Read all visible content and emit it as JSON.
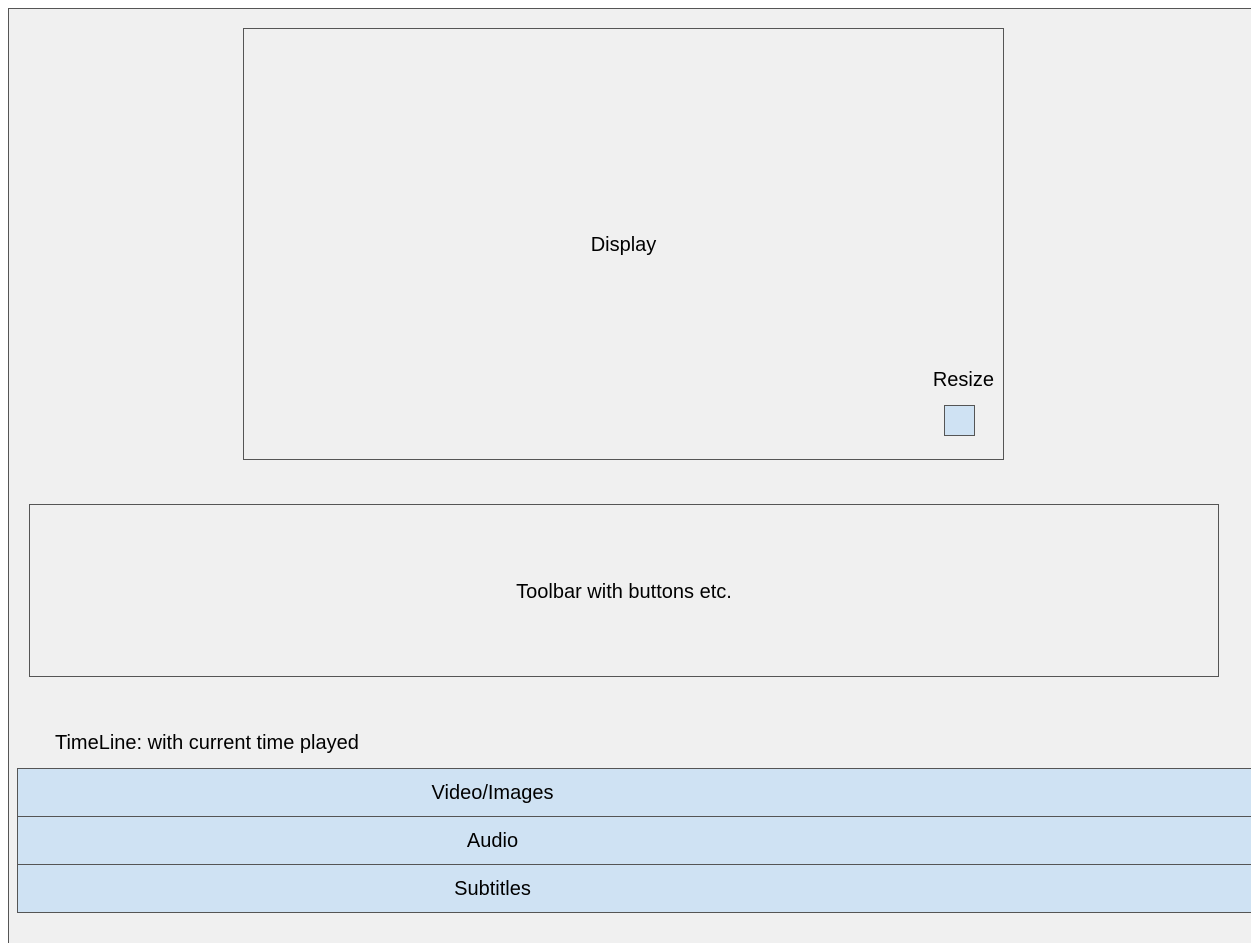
{
  "display": {
    "label": "Display",
    "resize_label": "Resize"
  },
  "toolbar": {
    "label": "Toolbar with buttons etc."
  },
  "timeline": {
    "label": "TimeLine: with current time played",
    "tracks": [
      {
        "label": "Video/Images"
      },
      {
        "label": "Audio"
      },
      {
        "label": "Subtitles"
      }
    ]
  },
  "colors": {
    "track_fill": "#cfe2f3",
    "background": "#f0f0f0",
    "border": "#555555"
  }
}
